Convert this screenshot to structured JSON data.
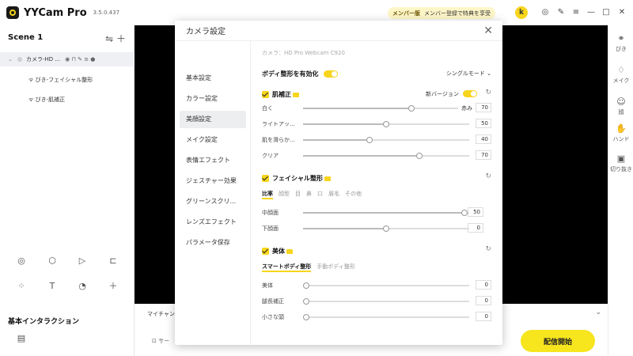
{
  "app": {
    "name": "YYCam Pro",
    "version": "3.5.0.437",
    "member_label": "メンバー版",
    "member_cta": "メンバー登録で特典を享受",
    "avatar": "k"
  },
  "left": {
    "scene": "Scene 1",
    "camera_item": "カメラ-HD ...",
    "children": [
      "びき-フェイシャル整形",
      "びき-肌補正"
    ],
    "basic_interaction": "基本インタラクション"
  },
  "right": {
    "items": [
      "びき",
      "メイク",
      "顔",
      "ハンド",
      "切り抜き"
    ]
  },
  "bottom": {
    "mic": "マイチャン",
    "source": "サー",
    "go_live": "配信開始"
  },
  "dialog": {
    "title": "カメラ設定",
    "nav": [
      "基本設定",
      "カラー設定",
      "美顔設定",
      "メイク設定",
      "表情エフェクト",
      "ジェスチャー効果",
      "グリーンスクリ...",
      "レンズエフェクト",
      "パラメータ保存"
    ],
    "camera": "カメラ：HD Pro Webcam C920",
    "body_enable": "ボディ整形を有効化",
    "mode": "シングルモード",
    "skin": {
      "title": "肌補正",
      "new_version": "新バージョン",
      "sliders": [
        {
          "label": "白く",
          "value": 70,
          "right": "赤み"
        },
        {
          "label": "ライトアッ...",
          "value": 50
        },
        {
          "label": "肌を滑らか...",
          "value": 40
        },
        {
          "label": "クリア",
          "value": 70
        }
      ]
    },
    "facial": {
      "title": "フェイシャル整形",
      "tabs": [
        "比率",
        "顔型",
        "目",
        "鼻",
        "口",
        "眉毛",
        "その他"
      ],
      "sliders": [
        {
          "label": "中顔面",
          "value": 50
        },
        {
          "label": "下顔面",
          "value": 0
        }
      ]
    },
    "body": {
      "title": "美体",
      "tabs": [
        "スマートボディ整形",
        "手動ボディ整形"
      ],
      "sliders": [
        {
          "label": "美体",
          "value": 0
        },
        {
          "label": "腿長補正",
          "value": 0
        },
        {
          "label": "小さな頭",
          "value": 0
        }
      ]
    }
  }
}
